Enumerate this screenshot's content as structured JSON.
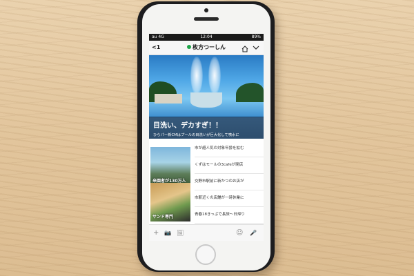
{
  "status": {
    "signal": "au 4G",
    "time": "12:04",
    "battery": "89%"
  },
  "nav": {
    "back": "<1",
    "title": "枚方つーしん",
    "home_icon": "house-icon",
    "menu_icon": "chevron-down-icon"
  },
  "hero": {
    "headline": "目洗い、デカすぎ！！",
    "subhead": "ひらパー新CMはプールの目洗いが巨大化して噴水に"
  },
  "thumbs": [
    {
      "caption": "来園者が130万人"
    },
    {
      "caption": "サンド専門"
    }
  ],
  "articles": [
    {
      "title": "市が超人気の対象年齢を拡む"
    },
    {
      "title": "くずはモールの3cafeが閉店"
    },
    {
      "title": "交野市駅前に新かつのお店が"
    },
    {
      "title": "市駅近くの店舗が一時休業に"
    },
    {
      "title": "青春18きっぷで長旅～日帰り"
    }
  ],
  "toolbar": {
    "plus": "+",
    "camera": "📷",
    "image": "🖼",
    "emoji": "☺",
    "mic": "🎤"
  }
}
